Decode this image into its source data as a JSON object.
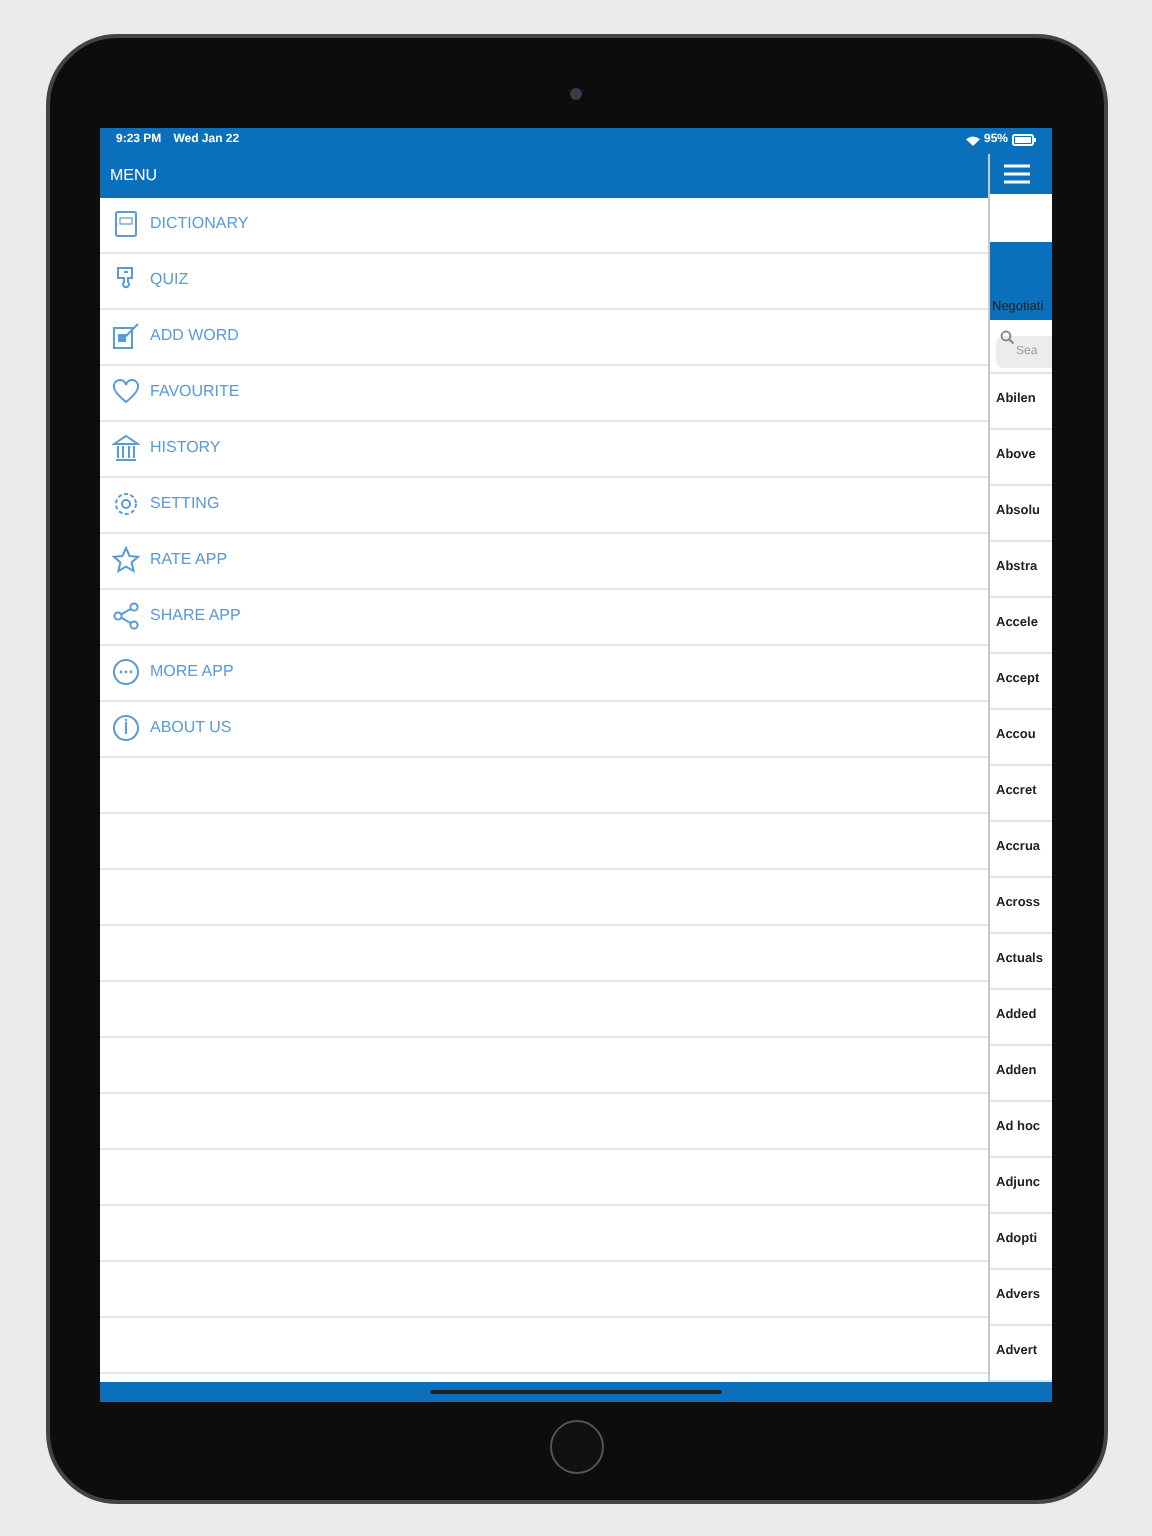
{
  "status_bar": {
    "time": "9:23 PM",
    "date": "Wed Jan 22",
    "battery": "95%"
  },
  "menu": {
    "title": "MENU",
    "items": [
      {
        "label": "DICTIONARY"
      },
      {
        "label": "QUIZ"
      },
      {
        "label": "ADD WORD"
      },
      {
        "label": "FAVOURITE"
      },
      {
        "label": "HISTORY"
      },
      {
        "label": "SETTING"
      },
      {
        "label": "RATE APP"
      },
      {
        "label": "SHARE APP"
      },
      {
        "label": "MORE APP"
      },
      {
        "label": "ABOUT US"
      }
    ]
  },
  "main_panel": {
    "banner_text": "Negotiati",
    "search": {
      "placeholder": "Sea"
    },
    "words": [
      "Abilen",
      "Above",
      "Absolu",
      "Abstra",
      "Accele",
      "Accept",
      "Accou",
      "Accret",
      "Accrua",
      "Across",
      "Actuals",
      "Added",
      "Adden",
      "Ad hoc",
      "Adjunc",
      "Adopti",
      "Advers",
      "Advert"
    ]
  }
}
